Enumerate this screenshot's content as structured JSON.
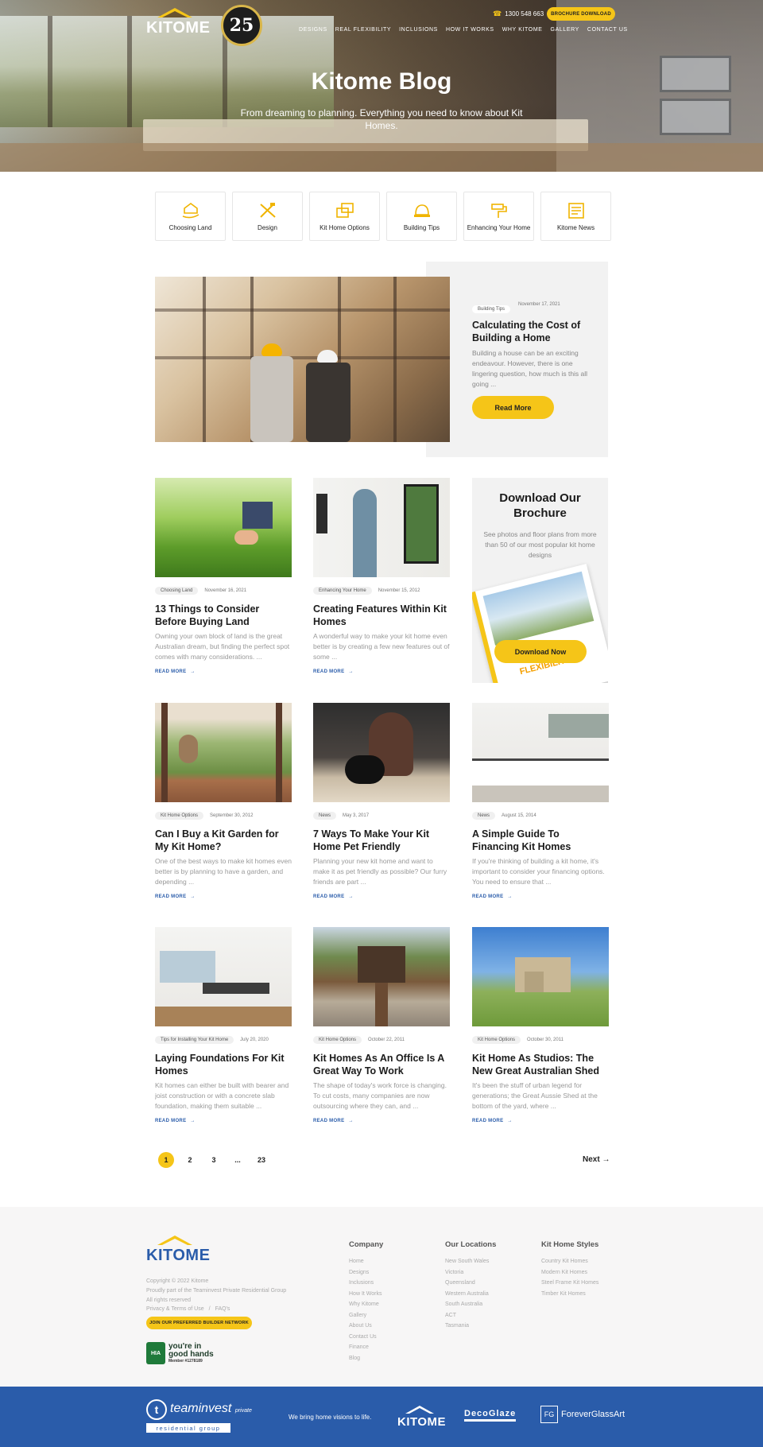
{
  "header": {
    "logo_text": "KITOME",
    "badge_text": "25",
    "phone": "1300 548 663",
    "brochure_button": "BROCHURE DOWNLOAD",
    "nav": [
      "DESIGNS",
      "REAL FLEXIBILITY",
      "INCLUSIONS",
      "HOW IT WORKS",
      "WHY KITOME",
      "GALLERY",
      "CONTACT US"
    ],
    "title": "Kitome Blog",
    "subtitle": "From dreaming to planning. Everything you need to know about Kit Homes."
  },
  "categories": [
    {
      "label": "Choosing Land",
      "icon": "hand-house-icon"
    },
    {
      "label": "Design",
      "icon": "pencil-ruler-icon"
    },
    {
      "label": "Kit Home Options",
      "icon": "kit-boxes-icon"
    },
    {
      "label": "Building Tips",
      "icon": "helmet-icon"
    },
    {
      "label": "Enhancing Your Home",
      "icon": "paint-icon"
    },
    {
      "label": "Kitome News",
      "icon": "newspaper-icon"
    }
  ],
  "featured": {
    "category": "Building Tips",
    "date": "November 17, 2021",
    "title": "Calculating the Cost of Building a Home",
    "excerpt": "Building a house can be an exciting endeavour. However, there is one lingering question, how much is this all going ...",
    "button": "Read More"
  },
  "brochure": {
    "title": "Download Our Brochure",
    "text": "See photos and floor plans from more than 50 of our most popular kit home designs",
    "book_word": "FLEXIBILITY",
    "button": "Download Now"
  },
  "posts": [
    {
      "category": "Choosing Land",
      "date": "November 16, 2021",
      "title": "13 Things to Consider Before Buying Land",
      "excerpt": "Owning your own block of land is the great Australian dream, but finding the perfect spot comes with many considerations. ...",
      "more": "READ MORE"
    },
    {
      "category": "Enhancing Your Home",
      "date": "November 15, 2012",
      "title": "Creating Features Within Kit Homes",
      "excerpt": "A wonderful way to make your kit home even better is by creating a few new features out of some ...",
      "more": "READ MORE"
    },
    {
      "category": "Kit Home Options",
      "date": "September 30, 2012",
      "title": "Can I Buy a Kit Garden for My Kit Home?",
      "excerpt": "One of the best ways to make kit homes even better is by planning to have a garden, and depending ...",
      "more": "READ MORE"
    },
    {
      "category": "News",
      "date": "May 3, 2017",
      "title": "7 Ways To Make Your Kit Home Pet Friendly",
      "excerpt": "Planning your new kit home and want to make it as pet friendly as possible? Our furry friends are part ...",
      "more": "READ MORE"
    },
    {
      "category": "News",
      "date": "August 15, 2014",
      "title": "A Simple Guide To Financing Kit Homes",
      "excerpt": "If you're thinking of building a kit home, it's important to consider your financing options. You need to ensure that ...",
      "more": "READ MORE"
    },
    {
      "category": "Tips for Installing Your Kit Home",
      "date": "July 20, 2020",
      "title": "Laying Foundations For Kit Homes",
      "excerpt": "Kit homes can either be built with bearer and joist construction or with a concrete slab foundation, making them suitable ...",
      "more": "READ MORE"
    },
    {
      "category": "Kit Home Options",
      "date": "October 22, 2011",
      "title": "Kit Homes As An Office Is A Great Way To Work",
      "excerpt": "The shape of today's work force is changing. To cut costs, many companies are now outsourcing where they can, and ...",
      "more": "READ MORE"
    },
    {
      "category": "Kit Home Options",
      "date": "October 30, 2011",
      "title": "Kit Home As Studios: The New Great Australian Shed",
      "excerpt": "It's been the stuff of urban legend for generations; the Great Aussie Shed at the bottom of the yard, where ...",
      "more": "READ MORE"
    }
  ],
  "pagination": {
    "pages": [
      "1",
      "2",
      "3",
      "...",
      "23"
    ],
    "current": "1",
    "next": "Next →"
  },
  "footer": {
    "logo_text": "KITOME",
    "copyright": "Copyright © 2022 Kitome",
    "proudly": "Proudly part of the Teaminvest Private Residential Group",
    "rights": "All rights reserved",
    "privacy": "Privacy & Terms of Use",
    "separator": "/",
    "faqs": "FAQ's",
    "builder_button": "JOIN OUR PREFERRED BUILDER NETWORK",
    "hia_logo": "HIA",
    "hia_line1": "you're in",
    "hia_line2": "good hands",
    "hia_member": "Member #1278189",
    "columns": [
      {
        "title": "Company",
        "items": [
          "Home",
          "Designs",
          "Inclusions",
          "How It Works",
          "Why Kitome",
          "Gallery",
          "About Us",
          "Contact Us",
          "Finance",
          "Blog"
        ]
      },
      {
        "title": "Our Locations",
        "items": [
          "New South Wales",
          "Victoria",
          "Queensland",
          "Western Australia",
          "South Australia",
          "ACT",
          "Tasmania"
        ]
      },
      {
        "title": "Kit Home Styles",
        "items": [
          "Country Kit Homes",
          "Modern Kit Homes",
          "Steel Frame Kit Homes",
          "Timber Kit Homes"
        ]
      }
    ]
  },
  "bottom_bar": {
    "teaminvest": "teaminvest",
    "teaminvest_sub": "private",
    "residential": "residential group",
    "tagline": "We bring home visions to life.",
    "kitome": "KITOME",
    "decoglaze": "DecoGlaze",
    "forever_mark": "FG",
    "forever": "ForeverGlassArt"
  },
  "colors": {
    "accent": "#f5c518",
    "brand_blue": "#2a5caa",
    "link": "#2a5caa"
  }
}
